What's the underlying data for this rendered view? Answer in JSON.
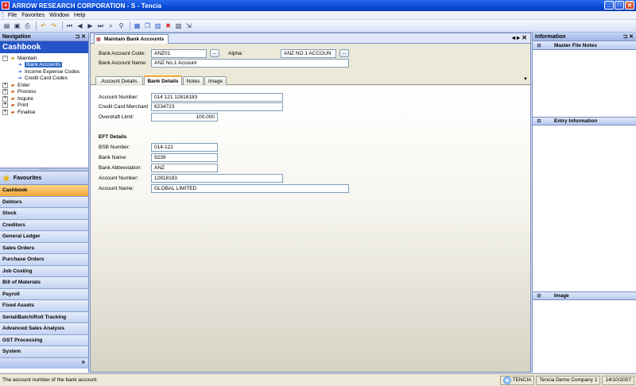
{
  "window": {
    "title": "ARROW RESEARCH CORPORATION - S - Tencia",
    "icon_letter": "a",
    "controls": [
      "_",
      "□",
      "✕"
    ]
  },
  "menu": {
    "items": [
      "File",
      "Favorites",
      "Window",
      "Help"
    ]
  },
  "toolbar": {
    "icons": [
      "new-icon",
      "save-icon",
      "print-icon",
      "undo-icon",
      "redo-icon",
      "first-icon",
      "previous-icon",
      "next-icon",
      "last-icon",
      "find-icon",
      "post-icon",
      "save-record-icon",
      "copy-icon",
      "attach-icon",
      "delete-icon",
      "report-icon",
      "export-icon"
    ]
  },
  "navigation": {
    "header": "Navigation",
    "header_controls": "⊐ ✕",
    "title": "Cashbook",
    "tree": [
      {
        "label": "Maintain",
        "expander": "−",
        "level": 0
      },
      {
        "label": "Bank Accounts",
        "level": 1,
        "selected": true
      },
      {
        "label": "Income Expense Codes",
        "level": 1
      },
      {
        "label": "Credit Card Codes",
        "level": 1
      },
      {
        "label": "Enter",
        "expander": "+",
        "level": 0
      },
      {
        "label": "Process",
        "expander": "+",
        "level": 0
      },
      {
        "label": "Inquire",
        "expander": "+",
        "level": 0
      },
      {
        "label": "Print",
        "expander": "+",
        "level": 0
      },
      {
        "label": "Finalise",
        "expander": "+",
        "level": 0
      }
    ],
    "splitter_glyph": "::::::::",
    "favourites": "Favourites",
    "modules": [
      "Cashbook",
      "Debtors",
      "Stock",
      "Creditors",
      "General Ledger",
      "Sales Orders",
      "Purchase Orders",
      "Job Costing",
      "Bill of Materials",
      "Payroll",
      "Fixed Assets",
      "Serial/Batch/Roll Tracking",
      "Advanced Sales Analysis",
      "GST Processing",
      "System"
    ],
    "active_module": "Cashbook",
    "footer_glyph": "»"
  },
  "document": {
    "tab_label": "Maintain Bank Accounts",
    "tab_controls": "◂ ▸ ✕",
    "bank_account_code_label": "Bank Account Code:",
    "bank_account_code": "ANZ01",
    "alpha_label": "Alpha:",
    "alpha": "ANZ NO.1 ACCOUN",
    "bank_account_name_label": "Bank Account Name:",
    "bank_account_name": "ANZ No.1 Account",
    "lookup_glyph": "...",
    "sub_tabs": [
      "Account Details",
      "Bank Details",
      "Notes",
      "Image"
    ],
    "active_sub_tab": "Bank Details",
    "dropdown_glyph": "▼",
    "bank_details": {
      "account_number_label": "Account Number:",
      "account_number": "014 121 12818183",
      "credit_card_merchant_label": "Credit Card Merchant",
      "credit_card_merchant": "6234723",
      "overdraft_limit_label": "Overdraft Limit:",
      "overdraft_limit": "100.000",
      "eft_title": "EFT Details",
      "bsb_number_label": "BSB Number:",
      "bsb_number": "014-121",
      "bank_name_label": "Bank Name:",
      "bank_name": "9239",
      "bank_abbreviation_label": "Bank Abbreviation:",
      "bank_abbreviation": "ANZ",
      "eft_account_number_label": "Account Number:",
      "eft_account_number": "12818183",
      "account_name_label": "Account Name:",
      "account_name": "GLOBAL LIMITED"
    }
  },
  "information": {
    "header": "Information",
    "header_controls": "⊐ ✕",
    "sections": [
      "Master File Notes",
      "Entry Information",
      "Image"
    ],
    "toggle_glyph": "⊟"
  },
  "status": {
    "message": "The account number of the bank account.",
    "server": "TENCIA",
    "company": "Tencia Demo Company 1",
    "date": "14/10/2007"
  },
  "colors": {
    "title_bar": "#0b4ad8",
    "nav_title": "#2454c8",
    "active_module": "#f1a63a",
    "selection": "#316ac5"
  }
}
